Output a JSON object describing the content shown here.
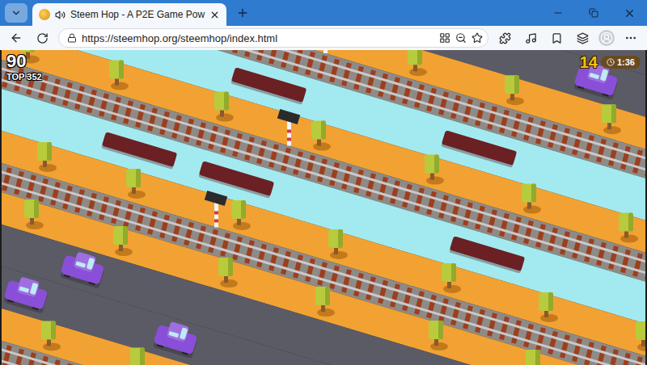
{
  "tabs": [
    {
      "label": "Steem Hop - A P2E Game Pow",
      "selected": true,
      "audio_playing": true
    }
  ],
  "address_bar": {
    "url": "https://steemhop.org/steemhop/index.html"
  },
  "hud": {
    "score": "90",
    "top": "TOP 352",
    "coins": "14",
    "timer": "1:36"
  },
  "game": {
    "lanes": [
      {
        "kind": "grass"
      },
      {
        "kind": "road"
      },
      {
        "kind": "road"
      },
      {
        "kind": "grass"
      },
      {
        "kind": "rail"
      },
      {
        "kind": "water"
      },
      {
        "kind": "grass"
      },
      {
        "kind": "rail"
      },
      {
        "kind": "water"
      },
      {
        "kind": "grass"
      },
      {
        "kind": "rail"
      },
      {
        "kind": "grass"
      },
      {
        "kind": "road"
      },
      {
        "kind": "road"
      },
      {
        "kind": "grass"
      },
      {
        "kind": "rail"
      },
      {
        "kind": "water"
      }
    ],
    "cars": [
      {
        "color": "#e0633f"
      },
      {
        "color": "#8a4fd8"
      },
      {
        "color": "#8a4fd8"
      },
      {
        "color": "#8a4fd8"
      },
      {
        "color": "#e0633f"
      },
      {
        "color": "#8a4fd8"
      },
      {
        "color": "#8a4fd8"
      }
    ]
  }
}
